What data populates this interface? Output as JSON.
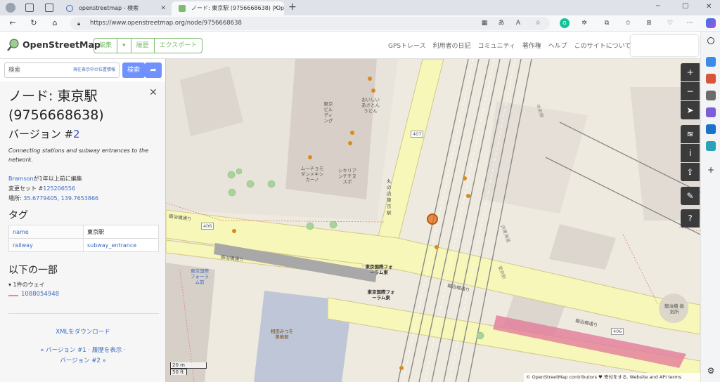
{
  "browser": {
    "tabs": [
      {
        "label": "openstreetmap - 検索"
      },
      {
        "label": "ノード: 東京駅 (9756668638) | Ope"
      }
    ],
    "url": "https://www.openstreetmap.org/node/9756668638",
    "new_tab": "+",
    "window_controls": [
      "─",
      "▢",
      "✕"
    ]
  },
  "osm": {
    "logo": "OpenStreetMap",
    "edit": [
      "編集",
      "▾",
      "履歴",
      "エクスポート"
    ],
    "nav": [
      "GPSトレース",
      "利用者の日記",
      "コミュニティ",
      "著作権",
      "ヘルプ",
      "このサイトについて"
    ]
  },
  "sidebar": {
    "search_placeholder": "検索",
    "search_hint": "現在表示中の位置情報",
    "search_button": "検索",
    "title": "ノード: 東京駅 (9756668638)",
    "version_label": "バージョン #",
    "version_num": "2",
    "comment": "Connecting stations and subway entrances to the network.",
    "editor_user": "Bramson",
    "editor_suffix": "が1年以上前に編集",
    "changeset_label": "変更セット #",
    "changeset": "125206556",
    "location_label": "場所: ",
    "location": "35.6779405, 139.7653866",
    "tags_heading": "タグ",
    "tags": [
      {
        "k": "name",
        "v": "東京駅"
      },
      {
        "k": "railway",
        "v": "subway_entrance"
      }
    ],
    "part_of_heading": "以下の一部",
    "part_of_sub": "▾ 1件のウェイ",
    "way_id": "1088054948",
    "xml_link": "XMLをダウンロード",
    "version_nav_1": "« バージョン #1 · 履歴を表示 ·",
    "version_nav_2": "バージョン #2 »"
  },
  "map": {
    "labels": {
      "bldg": "東京ビルディング",
      "road406a": "406",
      "road406b": "406",
      "road407": "407",
      "meiji1": "鍛治橋通り",
      "meiji2": "鍛治橋通り",
      "meiji3": "鍛治橋通り",
      "meiji4": "鍛治橋通り",
      "marunouchi": "丸の内東京駅",
      "station1": "東京国際フォーラム東",
      "station2": "東京国際フォーラム東",
      "forum": "東京国際フォーラム前",
      "aida": "相田みつを美術館",
      "kaji": "鍛治橋 換気所",
      "ramen": "おいしいあさとんうどん",
      "shop1": "ムーチョモダンメキシカーノ",
      "shop2": "シキリアンチチヌスポ",
      "chuo": "中央線",
      "yaesu": "東京駅",
      "rlabel1": "JR東海道"
    },
    "controls": [
      "+",
      "−",
      "➤",
      "≋",
      "i",
      "⇪",
      "✎",
      "?"
    ],
    "scale_m": "20 m",
    "scale_ft": "50 ft",
    "attribution": "© OpenStreetMap contributors ♥ 寄付をする. Website and API terms",
    "accent": "#e06c1e"
  }
}
